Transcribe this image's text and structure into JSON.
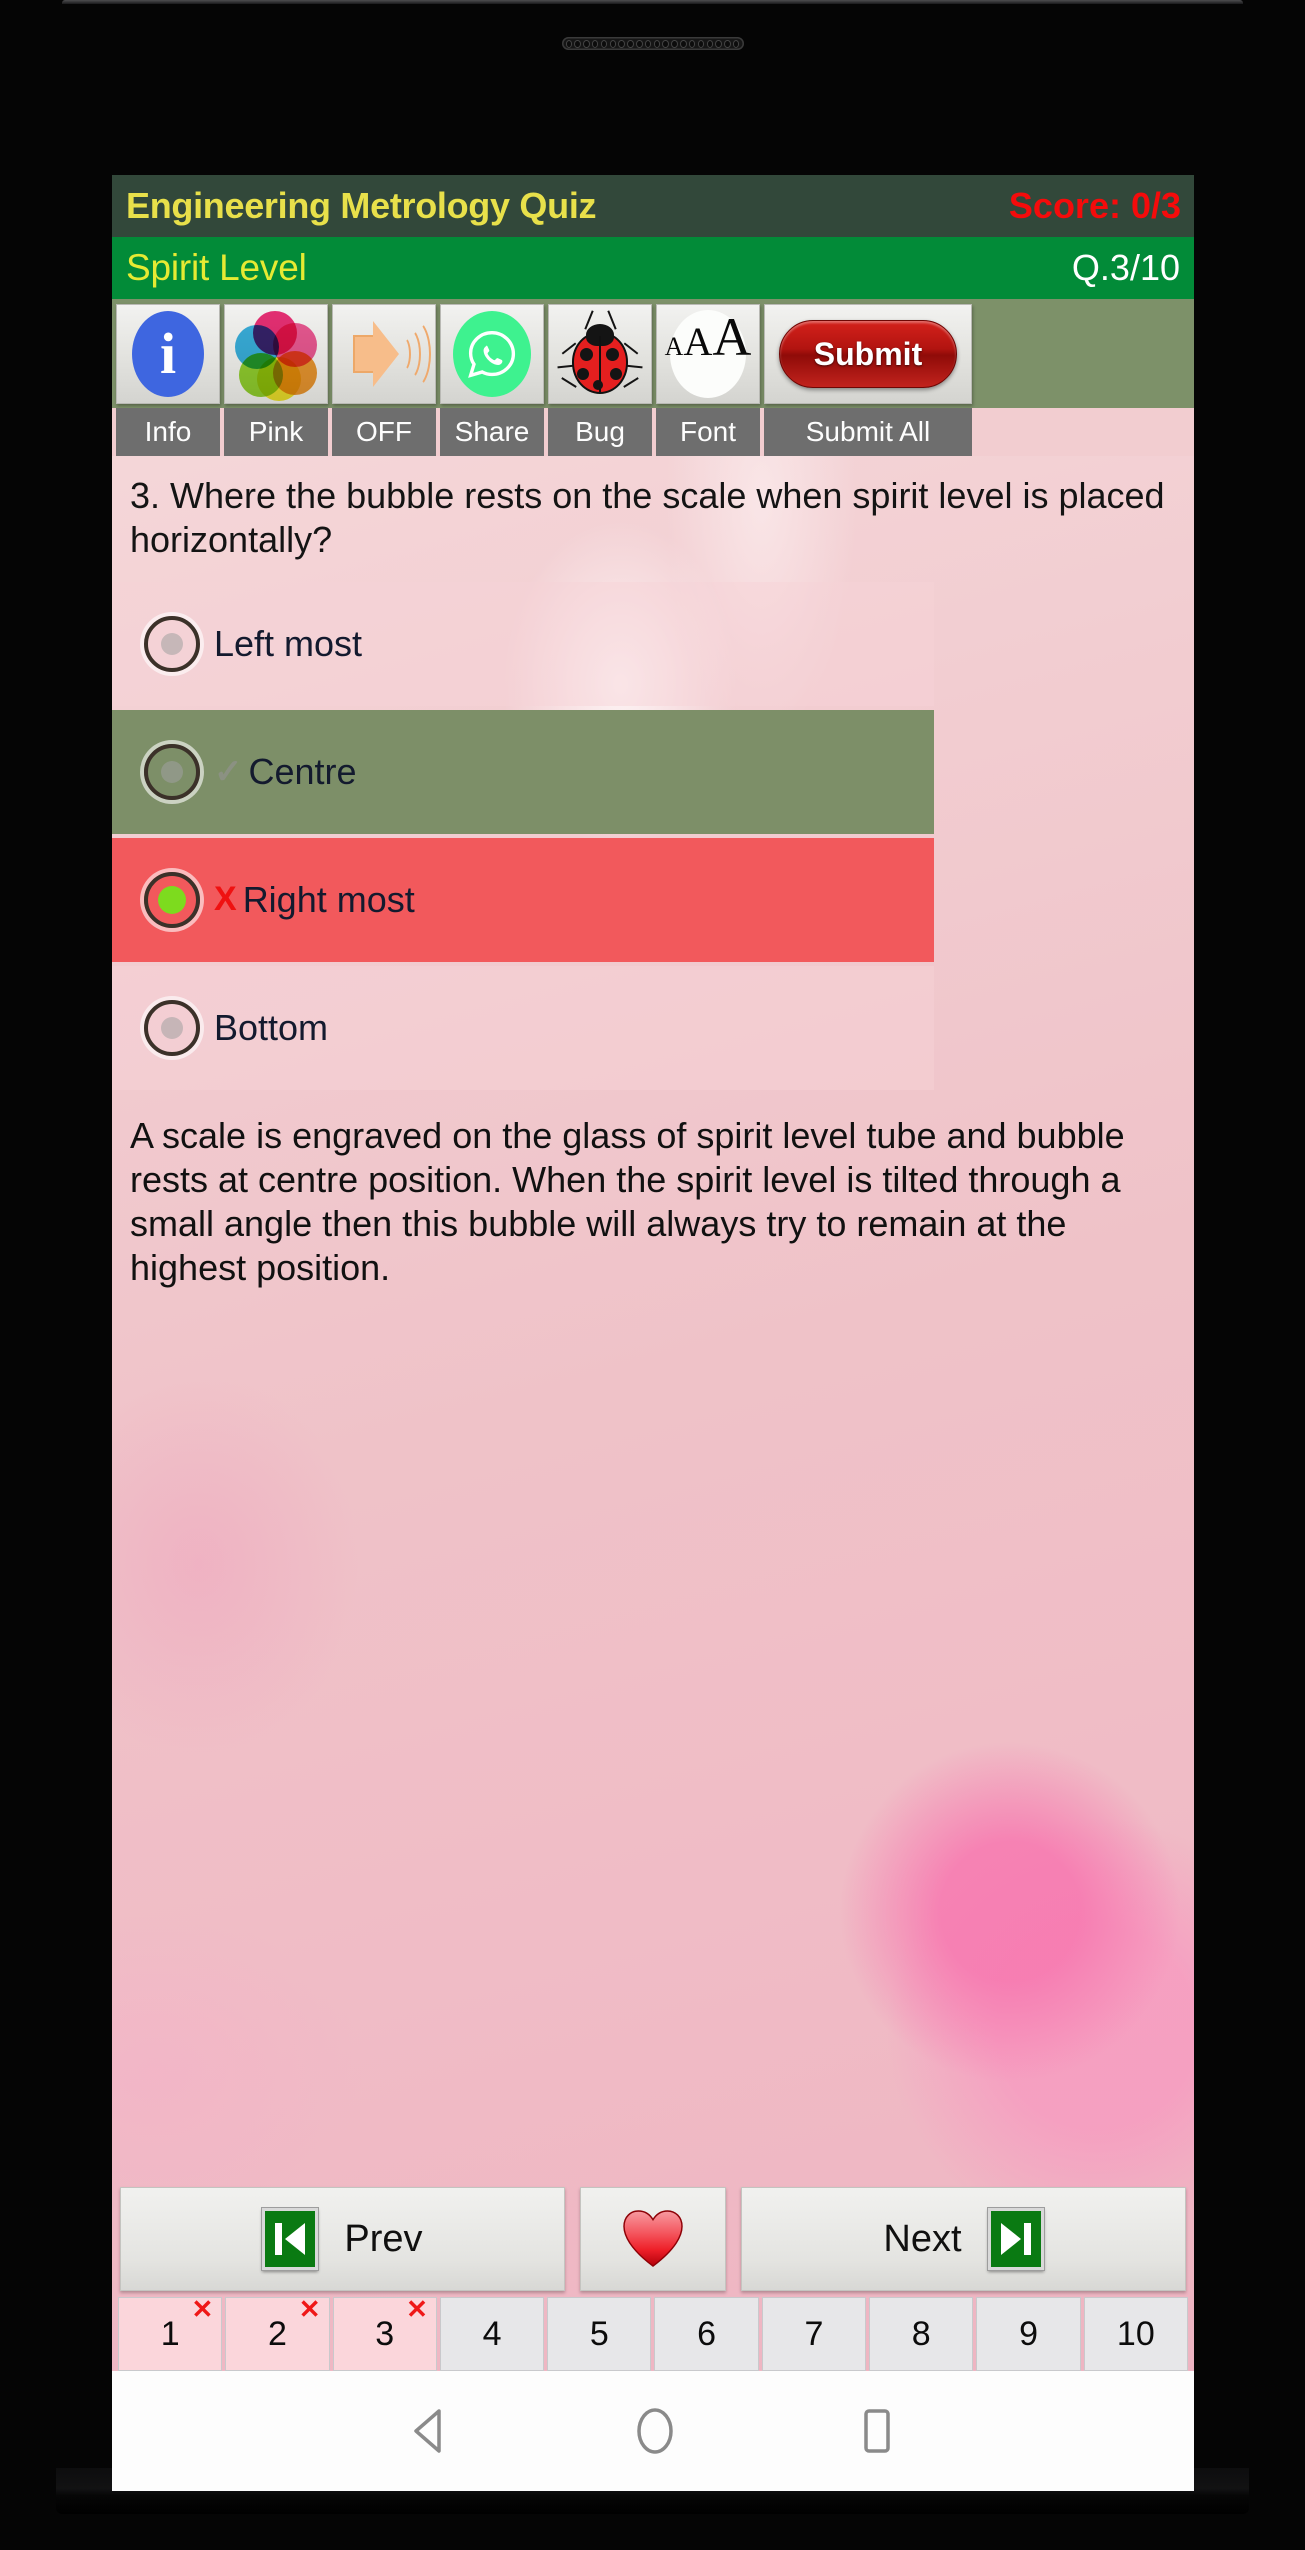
{
  "header": {
    "app_title": "Engineering Metrology Quiz",
    "score": "Score: 0/3",
    "topic": "Spirit Level",
    "question_counter": "Q.3/10",
    "title_bg": "#32483a",
    "topic_bg": "#028b38",
    "title_color": "#e8e04a",
    "score_color": "#f50b0b"
  },
  "toolbar": {
    "buttons": [
      {
        "icon": "info-icon",
        "label": "Info"
      },
      {
        "icon": "palette-icon",
        "label": "Pink"
      },
      {
        "icon": "speaker-icon",
        "label": "OFF"
      },
      {
        "icon": "whatsapp-share-icon",
        "label": "Share"
      },
      {
        "icon": "ladybug-icon",
        "label": "Bug"
      },
      {
        "icon": "font-size-icon",
        "label": "Font"
      },
      {
        "icon": "submit-icon",
        "label": "Submit All"
      }
    ],
    "submit_label": "Submit"
  },
  "question": {
    "text": "3. Where the bubble rests on the scale when spirit level is placed horizontally?",
    "options": [
      {
        "label": "Left most",
        "state": "plain",
        "selected": false,
        "mark": ""
      },
      {
        "label": "Centre",
        "state": "correct",
        "selected": false,
        "mark": "✓"
      },
      {
        "label": "Right most",
        "state": "wrong",
        "selected": true,
        "mark": "X"
      },
      {
        "label": "Bottom",
        "state": "plain",
        "selected": false,
        "mark": ""
      }
    ],
    "explanation": "A scale is engraved on the glass of spirit level tube and bubble rests at centre position. When the spirit level is tilted through a small angle then this bubble will always try to remain at the highest position."
  },
  "nav": {
    "prev_label": "Prev",
    "next_label": "Next",
    "favourite_icon": "heart-icon",
    "prev_icon": "skip-previous-icon",
    "next_icon": "skip-next-icon"
  },
  "question_numbers": [
    {
      "n": "1",
      "answered": true,
      "mark": "✕"
    },
    {
      "n": "2",
      "answered": true,
      "mark": "✕"
    },
    {
      "n": "3",
      "answered": true,
      "mark": "✕"
    },
    {
      "n": "4",
      "answered": false,
      "mark": ""
    },
    {
      "n": "5",
      "answered": false,
      "mark": ""
    },
    {
      "n": "6",
      "answered": false,
      "mark": ""
    },
    {
      "n": "7",
      "answered": false,
      "mark": ""
    },
    {
      "n": "8",
      "answered": false,
      "mark": ""
    },
    {
      "n": "9",
      "answered": false,
      "mark": ""
    },
    {
      "n": "10",
      "answered": false,
      "mark": ""
    }
  ],
  "system_nav": {
    "back": "back-icon",
    "home": "home-icon",
    "recents": "recents-icon"
  },
  "colors": {
    "correct_row": "#7d8f68",
    "wrong_row": "#f2595c",
    "toolbar_bg": "#7d9169",
    "label_bg": "#6e6e6e",
    "submit_red": "#b21410"
  }
}
